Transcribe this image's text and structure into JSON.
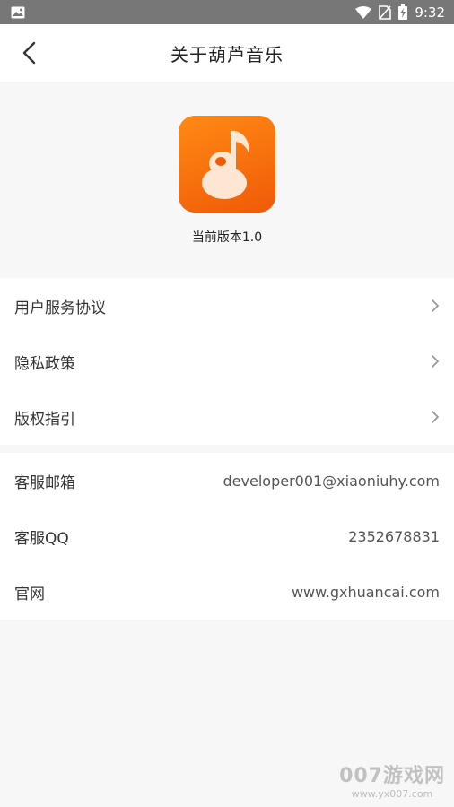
{
  "status_bar": {
    "time": "9:32",
    "icons": [
      "image-icon",
      "wifi-icon",
      "no-sim-icon",
      "battery-charging-icon"
    ]
  },
  "header": {
    "title": "关于葫芦音乐",
    "back_icon": "back-arrow-icon"
  },
  "app": {
    "icon": "gourd-music-note-icon",
    "version_text": "当前版本1.0",
    "brand_color": "#f26a0c"
  },
  "links": [
    {
      "label": "用户服务协议"
    },
    {
      "label": "隐私政策"
    },
    {
      "label": "版权指引"
    }
  ],
  "info": [
    {
      "label": "客服邮箱",
      "value": "developer001@xiaoniuhy.com"
    },
    {
      "label": "客服QQ",
      "value": "2352678831"
    },
    {
      "label": "官网",
      "value": "www.gxhuancai.com"
    }
  ],
  "watermark": {
    "main": "007游戏网",
    "url": "www.yx007.com"
  }
}
